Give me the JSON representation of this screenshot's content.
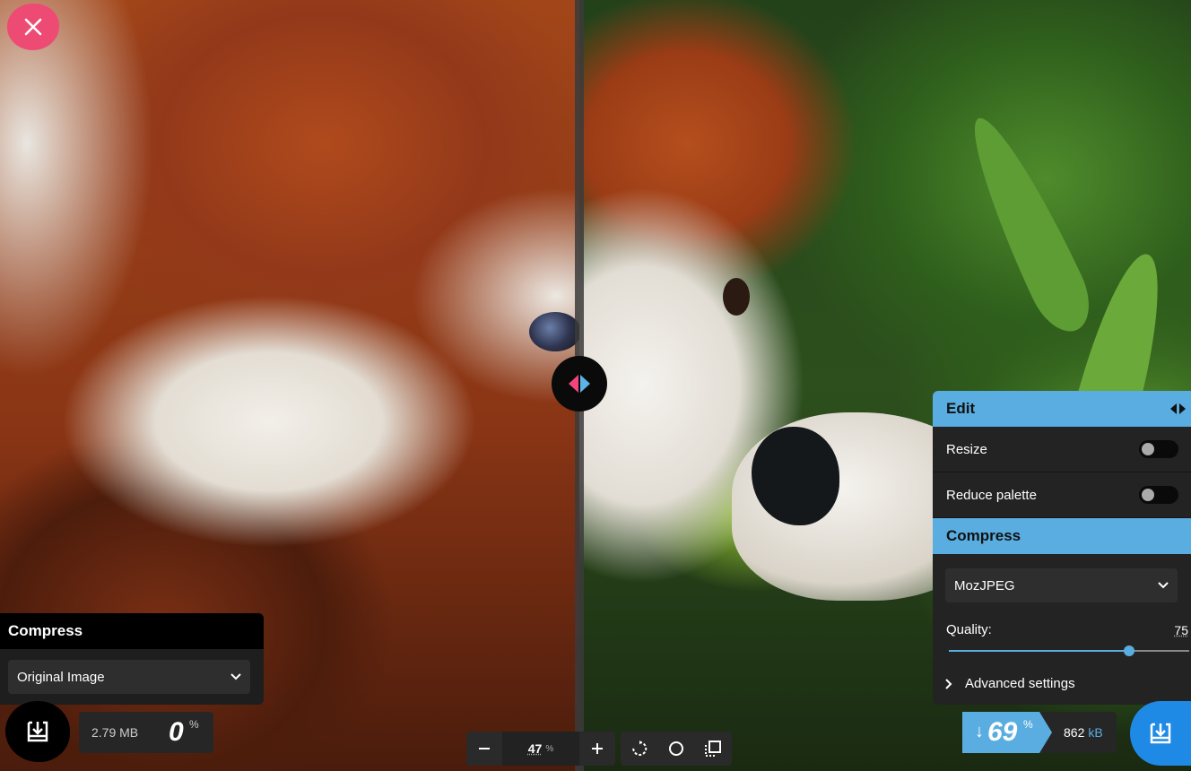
{
  "viewer": {
    "close_icon": "close-icon",
    "zoom": {
      "value": "47",
      "unit": "%",
      "minus": "−",
      "plus": "+"
    },
    "tools": [
      "rotate-icon",
      "circle-icon",
      "crop-icon"
    ]
  },
  "left": {
    "section_title": "Compress",
    "select_value": "Original Image",
    "size": "2.79 MB",
    "percent": "0",
    "percent_sign": "%"
  },
  "right": {
    "edit_title": "Edit",
    "resize_label": "Resize",
    "resize_on": false,
    "reduce_palette_label": "Reduce palette",
    "reduce_palette_on": false,
    "compress_title": "Compress",
    "codec_value": "MozJPEG",
    "quality_label": "Quality:",
    "quality_value": "75",
    "quality_fraction": 0.75,
    "advanced_label": "Advanced settings",
    "reduction_arrow": "↓",
    "reduction_percent": "69",
    "reduction_sign": "%",
    "result_size": "862",
    "result_unit": "kB"
  },
  "colors": {
    "accent_pink": "#ed4b73",
    "accent_blue": "#5aade0",
    "download_blue": "#1e8ae6"
  }
}
